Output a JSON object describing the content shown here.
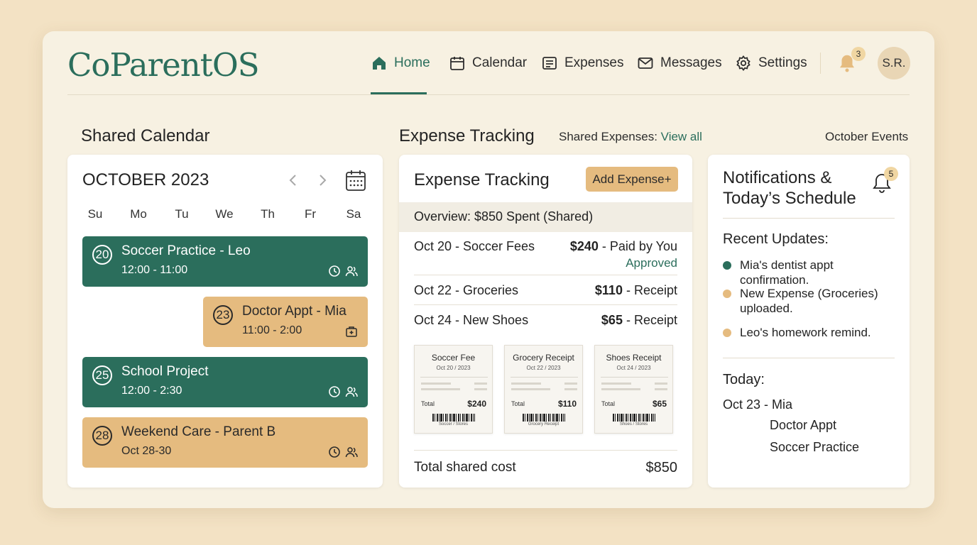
{
  "app": {
    "name": "CoParentOS"
  },
  "nav": {
    "items": [
      {
        "label": "Home",
        "icon": "home-icon",
        "active": true
      },
      {
        "label": "Calendar",
        "icon": "calendar-icon"
      },
      {
        "label": "Expenses",
        "icon": "expenses-icon"
      },
      {
        "label": "Messages",
        "icon": "mail-icon"
      },
      {
        "label": "Settings",
        "icon": "gear-icon"
      }
    ],
    "notif_count": "3",
    "user_initials": "S.R."
  },
  "sections": {
    "calendar_title": "Shared Calendar",
    "expense_title": "Expense Tracking",
    "shared_expenses_label": "Shared Expenses:",
    "view_all": "View all",
    "october_events": "October Events"
  },
  "calendar": {
    "month": "OCTOBER 2023",
    "days": [
      "Su",
      "Mo",
      "Tu",
      "We",
      "Th",
      "Fr",
      "Sa"
    ],
    "events": [
      {
        "day": "20",
        "title": "Soccer Practice - Leo",
        "time": "12:00 - 11:00",
        "color": "green"
      },
      {
        "day": "23",
        "title": "Doctor Appt - Mia",
        "time": "11:00 - 2:00",
        "color": "tan"
      },
      {
        "day": "25",
        "title": "School Project",
        "time": "12:00 - 2:30",
        "color": "green"
      },
      {
        "day": "28",
        "title": "Weekend Care - Parent B",
        "time": "Oct 28-30",
        "color": "tan"
      }
    ]
  },
  "expenses": {
    "title": "Expense Tracking",
    "add_button": "Add Expense+",
    "overview": "Overview: $850 Spent (Shared)",
    "rows": [
      {
        "label": "Oct 20 - Soccer Fees",
        "amount": "$240",
        "note": " - Paid by You",
        "status": "Approved"
      },
      {
        "label": "Oct 22 - Groceries",
        "amount": "$110",
        "note": " - Receipt"
      },
      {
        "label": "Oct 24 - New Shoes",
        "amount": "$65",
        "note": " - Receipt"
      }
    ],
    "receipts": [
      {
        "title": "Soccer Fee",
        "date": "Oct 20 / 2023",
        "total_label": "Total",
        "total": "$240",
        "barcode_label": "Soccer / Stores"
      },
      {
        "title": "Grocery Receipt",
        "date": "Oct 22 / 2023",
        "total_label": "Total",
        "total": "$110",
        "barcode_label": "Grocery Receipt"
      },
      {
        "title": "Shoes Receipt",
        "date": "Oct 24 / 2023",
        "total_label": "Total",
        "total": "$65",
        "barcode_label": "Shoes / Stores"
      }
    ],
    "total_label": "Total shared cost",
    "total_value": "$850"
  },
  "notifications": {
    "title": "Notifications & Today’s Schedule",
    "badge": "5",
    "recent_heading": "Recent Updates:",
    "updates": [
      {
        "text": "Mia's dentist appt confirmation.",
        "color": "#2b6e5c"
      },
      {
        "text": "New Expense (Groceries) uploaded.",
        "color": "#e5bb7f"
      },
      {
        "text": "Leo's homework remind.",
        "color": "#e5bb7f"
      }
    ],
    "today_heading": "Today:",
    "today_date": "Oct 23 - Mia",
    "today_items": [
      "Doctor Appt",
      "Soccer Practice"
    ]
  },
  "colors": {
    "accent": "#2b6e5c",
    "tan": "#e5bb7f",
    "background": "#f3e2c4"
  }
}
